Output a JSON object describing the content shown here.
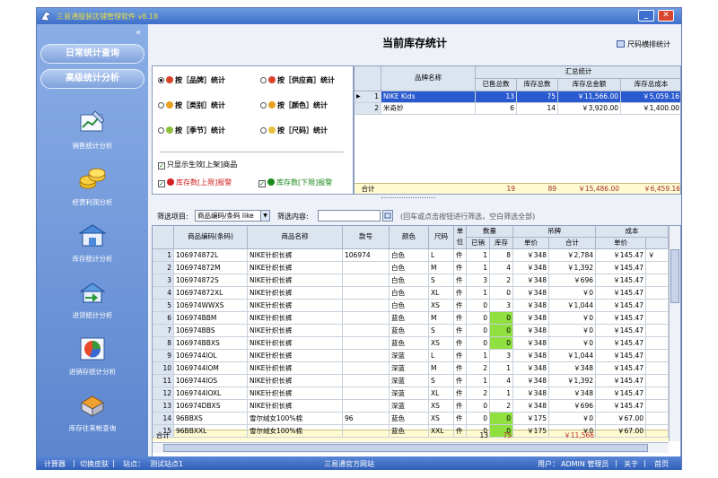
{
  "window": {
    "title": "三易通服装店铺管理软件 v8.18",
    "minimize": "_",
    "close": "✕"
  },
  "sidebar": {
    "collapse": "«",
    "daily_query": "日常统计查询",
    "advanced_analysis": "高级统计分析",
    "items": [
      {
        "label": "销售统计分析",
        "icon": "sales-chart-icon"
      },
      {
        "label": "经营利润分析",
        "icon": "coins-icon"
      },
      {
        "label": "库存统计分析",
        "icon": "warehouse-icon"
      },
      {
        "label": "进货统计分析",
        "icon": "purchase-icon"
      },
      {
        "label": "进销存统计分析",
        "icon": "pie-chart-icon"
      },
      {
        "label": "库存往来帐查询",
        "icon": "ledger-icon"
      }
    ]
  },
  "header": {
    "title": "当前库存统计",
    "size_stat": "尺码横排统计"
  },
  "options": {
    "radios": [
      {
        "label": "按［品牌］统计",
        "checked": true,
        "color": "#d8442a"
      },
      {
        "label": "按［供应商］统计",
        "checked": false,
        "color": "#d8442a"
      },
      {
        "label": "按［类别］统计",
        "checked": false,
        "color": "#e8a020"
      },
      {
        "label": "按［颜色］统计",
        "checked": false,
        "color": "#e8a020"
      },
      {
        "label": "按［季节］统计",
        "checked": false,
        "color": "#90c040"
      },
      {
        "label": "按［尺码］统计",
        "checked": false,
        "color": "#e8c040"
      }
    ],
    "only_active": "只显示生效[上架]商品",
    "warn_upper": "库存数[上限]报警",
    "warn_lower": "库存数[下限]报警",
    "warn_upper_color": "#d02020",
    "warn_lower_color": "#1a8a1a"
  },
  "summary": {
    "col_brand": "品牌名称",
    "group": "汇总统计",
    "cols": [
      "已售总数",
      "库存总数",
      "库存总金额",
      "库存总成本"
    ],
    "rows": [
      {
        "n": "1",
        "brand": "NIKE Kids",
        "sold": "13",
        "stock": "75",
        "amount": "￥11,566.00",
        "cost": "￥5,059.16",
        "selected": true
      },
      {
        "n": "2",
        "brand": "米奇妙",
        "sold": "6",
        "stock": "14",
        "amount": "￥3,920.00",
        "cost": "￥1,400.00",
        "selected": false
      }
    ],
    "total": {
      "label": "合计",
      "sold": "19",
      "stock": "89",
      "amount": "￥15,486.00",
      "cost": "￥6,459.16"
    }
  },
  "filter": {
    "item_label": "筛选项目:",
    "item_value": "商品编码/条码 like",
    "content_label": "筛选内容:",
    "hint": "(回车或点击按钮进行筛选，空白筛选全部)"
  },
  "grid": {
    "headers": {
      "code": "商品编码(条码)",
      "name": "商品名称",
      "style": "款号",
      "color": "颜色",
      "size": "尺码",
      "unit": "单位",
      "qty": "数量",
      "sold": "已销",
      "stock": "库存",
      "tag": "吊牌",
      "tag_price": "单价",
      "tag_total": "合计",
      "cost": "成本",
      "cost_price": "单价"
    },
    "rows": [
      {
        "n": "1",
        "code": "106974872L",
        "name": "NIKE针织长裤",
        "style": "106974",
        "color": "白色",
        "size": "L",
        "unit": "件",
        "sold": "1",
        "stock": "8",
        "price": "￥348",
        "total": "￥2,784",
        "cost": "￥145.47",
        "extra": "￥",
        "green": false
      },
      {
        "n": "2",
        "code": "106974872M",
        "name": "NIKE针织长裤",
        "style": "",
        "color": "白色",
        "size": "M",
        "unit": "件",
        "sold": "1",
        "stock": "4",
        "price": "￥348",
        "total": "￥1,392",
        "cost": "￥145.47",
        "extra": "",
        "green": false
      },
      {
        "n": "3",
        "code": "106974872S",
        "name": "NIKE针织长裤",
        "style": "",
        "color": "白色",
        "size": "S",
        "unit": "件",
        "sold": "3",
        "stock": "2",
        "price": "￥348",
        "total": "￥696",
        "cost": "￥145.47",
        "extra": "",
        "green": false
      },
      {
        "n": "4",
        "code": "106974872XL",
        "name": "NIKE针织长裤",
        "style": "",
        "color": "白色",
        "size": "XL",
        "unit": "件",
        "sold": "1",
        "stock": "0",
        "price": "￥348",
        "total": "￥0",
        "cost": "￥145.47",
        "extra": "",
        "green": false
      },
      {
        "n": "5",
        "code": "106974WWXS",
        "name": "NIKE针织长裤",
        "style": "",
        "color": "白色",
        "size": "XS",
        "unit": "件",
        "sold": "0",
        "stock": "3",
        "price": "￥348",
        "total": "￥1,044",
        "cost": "￥145.47",
        "extra": "",
        "green": false
      },
      {
        "n": "6",
        "code": "106974BBM",
        "name": "NIKE针织长裤",
        "style": "",
        "color": "蓝色",
        "size": "M",
        "unit": "件",
        "sold": "0",
        "stock": "0",
        "price": "￥348",
        "total": "￥0",
        "cost": "￥145.47",
        "extra": "",
        "green": true
      },
      {
        "n": "7",
        "code": "106974BBS",
        "name": "NIKE针织长裤",
        "style": "",
        "color": "蓝色",
        "size": "S",
        "unit": "件",
        "sold": "0",
        "stock": "0",
        "price": "￥348",
        "total": "￥0",
        "cost": "￥145.47",
        "extra": "",
        "green": true
      },
      {
        "n": "8",
        "code": "106974BBXS",
        "name": "NIKE针织长裤",
        "style": "",
        "color": "蓝色",
        "size": "XS",
        "unit": "件",
        "sold": "0",
        "stock": "0",
        "price": "￥348",
        "total": "￥0",
        "cost": "￥145.47",
        "extra": "",
        "green": true
      },
      {
        "n": "9",
        "code": "1069744lOL",
        "name": "NIKE针织长裤",
        "style": "",
        "color": "深蓝",
        "size": "L",
        "unit": "件",
        "sold": "1",
        "stock": "3",
        "price": "￥348",
        "total": "￥1,044",
        "cost": "￥145.47",
        "extra": "",
        "green": false
      },
      {
        "n": "10",
        "code": "1069744lOM",
        "name": "NIKE针织长裤",
        "style": "",
        "color": "深蓝",
        "size": "M",
        "unit": "件",
        "sold": "2",
        "stock": "1",
        "price": "￥348",
        "total": "￥348",
        "cost": "￥145.47",
        "extra": "",
        "green": false
      },
      {
        "n": "11",
        "code": "1069744lOS",
        "name": "NIKE针织长裤",
        "style": "",
        "color": "深蓝",
        "size": "S",
        "unit": "件",
        "sold": "1",
        "stock": "4",
        "price": "￥348",
        "total": "￥1,392",
        "cost": "￥145.47",
        "extra": "",
        "green": false
      },
      {
        "n": "12",
        "code": "1069744lOXL",
        "name": "NIKE针织长裤",
        "style": "",
        "color": "深蓝",
        "size": "XL",
        "unit": "件",
        "sold": "2",
        "stock": "1",
        "price": "￥348",
        "total": "￥348",
        "cost": "￥145.47",
        "extra": "",
        "green": false
      },
      {
        "n": "13",
        "code": "106974DBXS",
        "name": "NIKE针织长裤",
        "style": "",
        "color": "深蓝",
        "size": "XS",
        "unit": "件",
        "sold": "0",
        "stock": "2",
        "price": "￥348",
        "total": "￥696",
        "cost": "￥145.47",
        "extra": "",
        "green": false
      },
      {
        "n": "14",
        "code": "96BBXS",
        "name": "雪尔绒女100%棉",
        "style": "96",
        "color": "蓝色",
        "size": "XS",
        "unit": "件",
        "sold": "0",
        "stock": "0",
        "price": "￥175",
        "total": "￥0",
        "cost": "￥67.00",
        "extra": "",
        "green": true
      },
      {
        "n": "15",
        "code": "96BBXXL",
        "name": "雪尔绒女100%棉",
        "style": "",
        "color": "蓝色",
        "size": "XXL",
        "unit": "件",
        "sold": "0",
        "stock": "0",
        "price": "￥175",
        "total": "￥0",
        "cost": "￥67.00",
        "extra": "",
        "green": true
      }
    ],
    "total": {
      "label": "合计",
      "sold": "13",
      "stock": "75",
      "total": "￥11,566"
    },
    "green_color": "#90e040"
  },
  "statusbar": {
    "calculator": "计算器",
    "switch_skin": "切换皮肤",
    "site_label": "站点：",
    "site_name": "测试站点1",
    "website": "三易通官方网站",
    "user_label": "用户：",
    "user_name": "ADMIN 管理员",
    "about": "关于",
    "home": "首页"
  }
}
